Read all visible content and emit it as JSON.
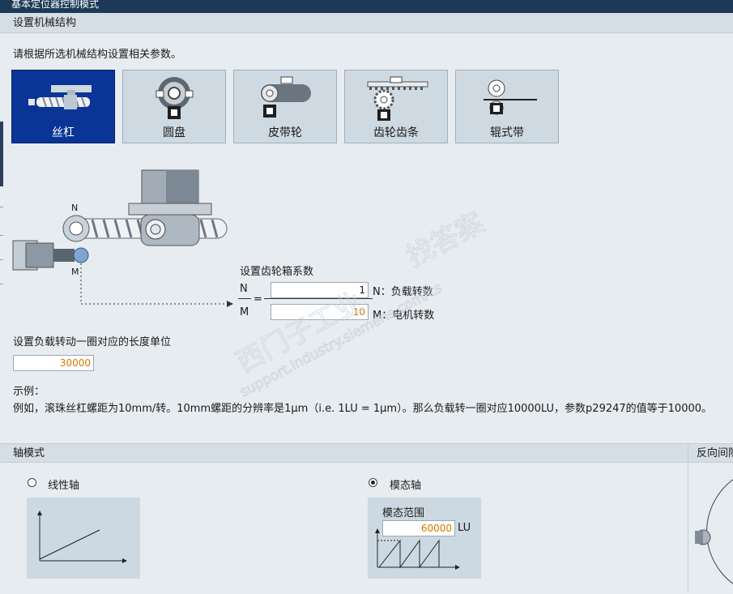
{
  "window": {
    "title": "基本定位器控制模式"
  },
  "section_mech": {
    "title": "设置机械结构",
    "instruction": "请根据所选机械结构设置相关参数。",
    "tiles": [
      {
        "label": "丝杠",
        "selected": true
      },
      {
        "label": "圆盘",
        "selected": false
      },
      {
        "label": "皮带轮",
        "selected": false
      },
      {
        "label": "齿轮齿条",
        "selected": false
      },
      {
        "label": "辊式带",
        "selected": false
      }
    ],
    "diagram_labels": {
      "n": "N",
      "m": "M"
    }
  },
  "gearbox": {
    "title": "设置齿轮箱系数",
    "n_symbol": "N",
    "m_symbol": "M",
    "equals": "=",
    "n_value": "1",
    "m_value": "10",
    "n_desc": "N：负载转数",
    "m_desc": "M：电机转数"
  },
  "length_unit": {
    "label": "设置负载转动一圈对应的长度单位",
    "value": "30000"
  },
  "example": {
    "title": "示例：",
    "text": "例如，滚珠丝杠螺距为10mm/转。10mm螺距的分辨率是1μm（i.e. 1LU = 1μm）。那么负载转一圈对应10000LU，参数p29247的值等于10000。"
  },
  "axis_mode": {
    "title": "轴模式",
    "linear_label": "线性轴",
    "modulo_label": "模态轴",
    "selected": "modulo",
    "modulo_range_label": "模态范围",
    "modulo_range_value": "60000",
    "modulo_unit": "LU"
  },
  "backlash": {
    "title": "反向间隙"
  },
  "watermark": {
    "line1": "西门子工业",
    "line2": "找答案",
    "line3": "support.industry.siemens.com/cs"
  },
  "colors": {
    "selected_tile": "#0a3596",
    "header_bar": "#1c3a57",
    "value_orange": "#d47a00"
  }
}
